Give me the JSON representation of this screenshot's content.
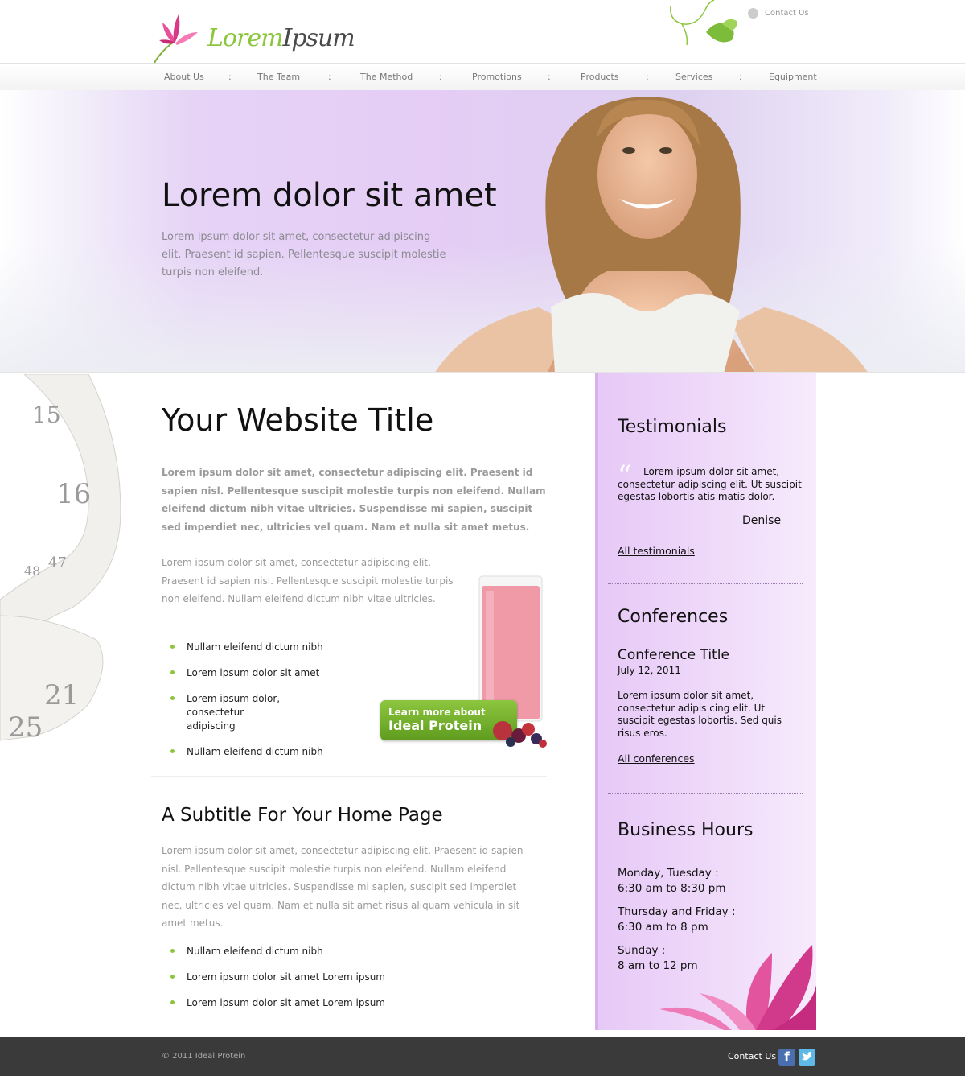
{
  "header": {
    "logo_word1": "Lorem",
    "logo_word2": "Ipsum",
    "contact_label": "Contact Us",
    "contact_icon": "contact-icon"
  },
  "nav": {
    "items": [
      "About Us",
      "The Team",
      "The Method",
      "Promotions",
      "Products",
      "Services",
      "Equipment"
    ],
    "separator": ":"
  },
  "hero": {
    "title": "Lorem dolor sit amet",
    "text": "Lorem ipsum dolor sit amet, consectetur adipiscing elit. Praesent id sapien. Pellentesque suscipit molestie turpis non eleifend."
  },
  "main": {
    "title": "Your Website Title",
    "lead": "Lorem ipsum dolor sit amet, consectetur adipiscing elit. Praesent id sapien nisl. Pellentesque suscipit molestie turpis non eleifend. Nullam eleifend dictum nibh vitae ultricies. Suspendisse mi sapien, suscipit sed imperdiet nec, ultricies vel quam. Nam et nulla sit amet metus.",
    "para": "Lorem ipsum dolor sit amet, consectetur adipiscing elit. Praesent id sapien nisl. Pellentesque suscipit molestie turpis non eleifend. Nullam eleifend dictum nibh vitae ultricies.",
    "bullets": [
      "Nullam eleifend dictum nibh",
      "Lorem ipsum dolor sit amet",
      "Lorem ipsum dolor, consectetur adipiscing",
      "Nullam eleifend dictum nibh"
    ],
    "promo_line1": "Learn more about",
    "promo_line2": "Ideal Protein",
    "subtitle": "A Subtitle For Your Home Page",
    "sub_para": "Lorem ipsum dolor sit amet, consectetur adipiscing elit. Praesent id sapien nisl. Pellentesque suscipit molestie turpis non eleifend. Nullam eleifend dictum nibh vitae ultricies. Suspendisse mi sapien, suscipit sed imperdiet nec, ultricies vel quam. Nam et nulla sit amet risus aliquam vehicula in sit amet metus.",
    "sub_bullets": [
      "Nullam eleifend dictum nibh",
      "Lorem ipsum dolor sit amet Lorem ipsum",
      "Lorem ipsum dolor sit amet Lorem ipsum"
    ]
  },
  "sidebar": {
    "testimonials": {
      "heading": "Testimonials",
      "quote": "Lorem ipsum dolor sit amet, consectetur adipiscing elit. Ut suscipit egestas lobortis atis matis dolor.",
      "author": "Denise",
      "link": "All testimonials"
    },
    "conferences": {
      "heading": "Conferences",
      "title": "Conference Title",
      "date": "July 12, 2011",
      "text": "Lorem ipsum dolor sit amet, consectetur adipis cing elit. Ut suscipit egestas lobortis. Sed quis risus eros.",
      "link": "All conferences"
    },
    "hours": {
      "heading": "Business Hours",
      "rows": [
        {
          "days": "Monday, Tuesday :",
          "time": "6:30 am to 8:30 pm"
        },
        {
          "days": "Thursday and Friday :",
          "time": "6:30 am to 8 pm"
        },
        {
          "days": "Sunday :",
          "time": "8 am to 12 pm"
        }
      ]
    }
  },
  "footer": {
    "copyright": "© 2011 Ideal Protein",
    "contact": "Contact Us",
    "icons": [
      "facebook-icon",
      "twitter-icon"
    ]
  },
  "colors": {
    "accent_green": "#8cc63e",
    "sidebar_purple": "#e6c8f6",
    "footer_bg": "#3a3a3a"
  }
}
